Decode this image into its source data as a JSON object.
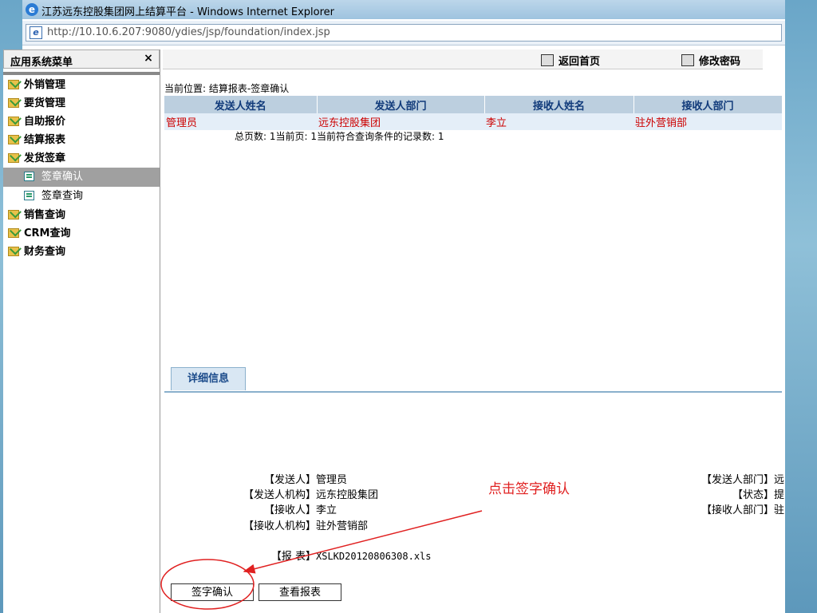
{
  "window": {
    "title": "江苏远东控股集团网上结算平台 - Windows Internet Explorer"
  },
  "address": {
    "url": "http://10.10.6.207:9080/ydies/jsp/foundation/index.jsp"
  },
  "sidebar": {
    "header": "应用系统菜单",
    "close": "×",
    "items": [
      {
        "label": "外销管理"
      },
      {
        "label": "要货管理"
      },
      {
        "label": "自助报价"
      },
      {
        "label": "结算报表"
      },
      {
        "label": "发货签章"
      }
    ],
    "subitems": [
      {
        "label": "签章确认",
        "active": true
      },
      {
        "label": "签章查询",
        "active": false
      }
    ],
    "items_after": [
      {
        "label": "销售查询"
      },
      {
        "label": "CRM查询"
      },
      {
        "label": "财务查询"
      }
    ]
  },
  "topbar": {
    "home": "返回首页",
    "password": "修改密码"
  },
  "breadcrumb": "当前位置: 结算报表-签章确认",
  "table": {
    "headers": [
      "发送人姓名",
      "发送人部门",
      "接收人姓名",
      "接收人部门"
    ],
    "rows": [
      [
        "管理员",
        "远东控股集团",
        "李立",
        "驻外营销部"
      ]
    ]
  },
  "pager": "总页数: 1当前页: 1当前符合查询条件的记录数: 1",
  "detail": {
    "tab": "详细信息",
    "fields": [
      {
        "label": "【发送人】",
        "value": "管理员"
      },
      {
        "label": "【发送人机构】",
        "value": "远东控股集团"
      },
      {
        "label": "【接收人】",
        "value": "李立"
      },
      {
        "label": "【接收人机构】",
        "value": "驻外营销部"
      }
    ],
    "right_fields": [
      {
        "label": "【发送人部门】",
        "value": "远"
      },
      {
        "label": "【状态】",
        "value": "提"
      },
      {
        "label": "【接收人部门】",
        "value": "驻"
      }
    ],
    "report": {
      "label": "【报 表】",
      "value": "XSLKD20120806308.xls"
    }
  },
  "buttons": {
    "confirm": "签字确认",
    "view": "查看报表"
  },
  "annotation": "点击签字确认",
  "colors": {
    "annotation": "#e02020",
    "header_bg": "#bccfdf",
    "row_text": "#cc0000"
  }
}
